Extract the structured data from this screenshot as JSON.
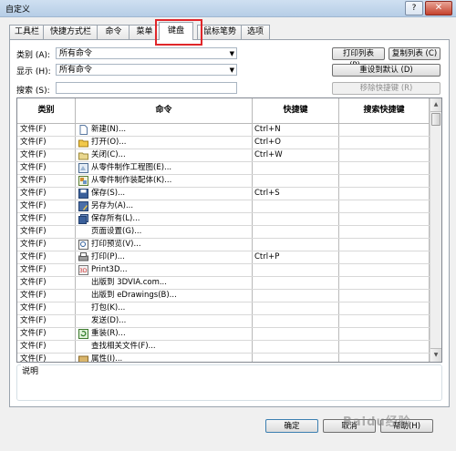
{
  "window": {
    "title": "自定义",
    "help_label": "?",
    "close_label": "✕"
  },
  "tabs": [
    {
      "label": "工具栏"
    },
    {
      "label": "快捷方式栏"
    },
    {
      "label": "命令"
    },
    {
      "label": "菜单"
    },
    {
      "label": "键盘"
    },
    {
      "label": "鼠标笔势"
    },
    {
      "label": "选项"
    }
  ],
  "filters": {
    "category_label": "类别 (A):",
    "category_value": "所有命令",
    "show_label": "显示 (H):",
    "show_value": "所有命令",
    "search_label": "搜索 (S):",
    "search_value": ""
  },
  "buttons": {
    "print_list": "打印列表 (P)...",
    "copy_list": "复制列表 (C)",
    "reset_default": "重设到默认 (D)",
    "remove_shortcut": "移除快捷键 (R)",
    "ok": "确定",
    "cancel": "取消",
    "help": "帮助(H)"
  },
  "table": {
    "headers": [
      "类别",
      "命令",
      "快捷键",
      "搜索快捷键"
    ],
    "rows": [
      {
        "category": "文件(F)",
        "command": "新建(N)...",
        "shortcut": "Ctrl+N",
        "search": "",
        "icon": "new-file-icon"
      },
      {
        "category": "文件(F)",
        "command": "打开(O)...",
        "shortcut": "Ctrl+O",
        "search": "",
        "icon": "open-folder-icon"
      },
      {
        "category": "文件(F)",
        "command": "关闭(C)...",
        "shortcut": "Ctrl+W",
        "search": "",
        "icon": "close-file-icon"
      },
      {
        "category": "文件(F)",
        "command": "从零件制作工程图(E)...",
        "shortcut": "",
        "search": "",
        "icon": "make-drawing-icon"
      },
      {
        "category": "文件(F)",
        "command": "从零件制作装配体(K)...",
        "shortcut": "",
        "search": "",
        "icon": "make-assembly-icon"
      },
      {
        "category": "文件(F)",
        "command": "保存(S)...",
        "shortcut": "Ctrl+S",
        "search": "",
        "icon": "save-icon"
      },
      {
        "category": "文件(F)",
        "command": "另存为(A)...",
        "shortcut": "",
        "search": "",
        "icon": "save-as-icon"
      },
      {
        "category": "文件(F)",
        "command": "保存所有(L)...",
        "shortcut": "",
        "search": "",
        "icon": "save-all-icon"
      },
      {
        "category": "文件(F)",
        "command": "页面设置(G)...",
        "shortcut": "",
        "search": "",
        "icon": ""
      },
      {
        "category": "文件(F)",
        "command": "打印预览(V)...",
        "shortcut": "",
        "search": "",
        "icon": "print-preview-icon"
      },
      {
        "category": "文件(F)",
        "command": "打印(P)...",
        "shortcut": "Ctrl+P",
        "search": "",
        "icon": "print-icon"
      },
      {
        "category": "文件(F)",
        "command": "Print3D...",
        "shortcut": "",
        "search": "",
        "icon": "print3d-icon"
      },
      {
        "category": "文件(F)",
        "command": "出版到 3DVIA.com...",
        "shortcut": "",
        "search": "",
        "icon": ""
      },
      {
        "category": "文件(F)",
        "command": "出版到 eDrawings(B)...",
        "shortcut": "",
        "search": "",
        "icon": ""
      },
      {
        "category": "文件(F)",
        "command": "打包(K)...",
        "shortcut": "",
        "search": "",
        "icon": ""
      },
      {
        "category": "文件(F)",
        "command": "发送(D)...",
        "shortcut": "",
        "search": "",
        "icon": ""
      },
      {
        "category": "文件(F)",
        "command": "重装(R)...",
        "shortcut": "",
        "search": "",
        "icon": "reload-icon"
      },
      {
        "category": "文件(F)",
        "command": "查找相关文件(F)...",
        "shortcut": "",
        "search": "",
        "icon": ""
      },
      {
        "category": "文件(F)",
        "command": "属性(I)...",
        "shortcut": "",
        "search": "",
        "icon": "properties-icon"
      }
    ]
  },
  "description": {
    "label": "说明"
  },
  "watermark": "Baidu经验"
}
